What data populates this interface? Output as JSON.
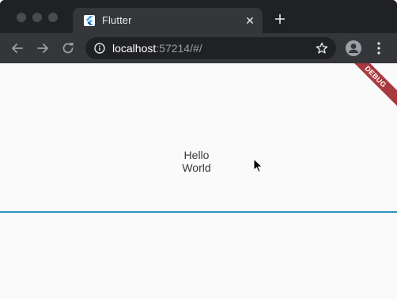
{
  "browser": {
    "tab": {
      "title": "Flutter",
      "close_glyph": "✕",
      "favicon": "flutter-logo-icon"
    },
    "address_bar": {
      "host": "localhost",
      "rest": ":57214/#/"
    },
    "icons": {
      "back": "arrow-left-icon",
      "forward": "arrow-right-icon",
      "reload": "reload-icon",
      "info": "info-icon",
      "bookmark": "star-icon",
      "profile": "profile-icon",
      "menu": "kebab-menu-icon",
      "new_tab": "plus-icon"
    },
    "colors": {
      "frame": "#202124",
      "toolbar": "#35363a"
    }
  },
  "app": {
    "greeting_line1": "Hello",
    "greeting_line2": "World",
    "debug_banner": "DEBUG",
    "divider_color": "#2a93bd",
    "background": "#fafafa"
  }
}
